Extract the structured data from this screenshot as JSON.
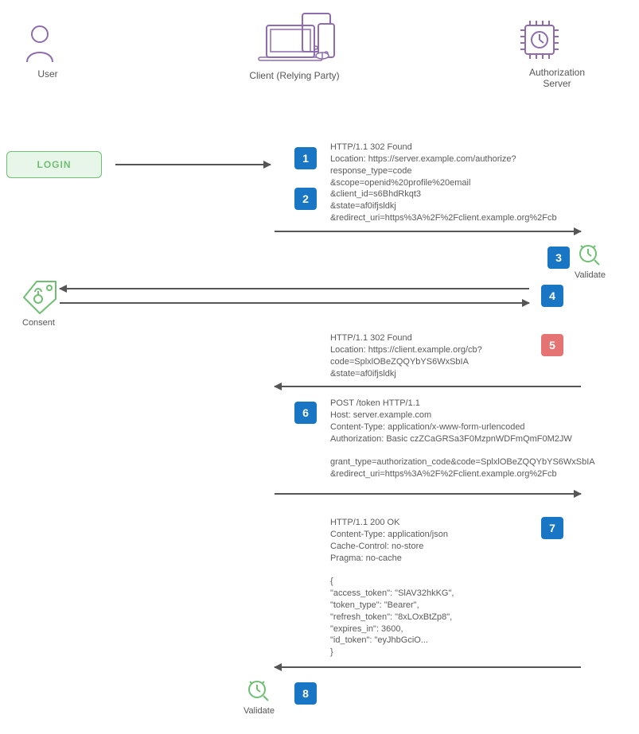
{
  "actors": {
    "user": "User",
    "client": "Client (Relying Party)",
    "server": "Authorization Server"
  },
  "login_label": "LOGIN",
  "validate_label_1": "Validate",
  "validate_label_2": "Validate",
  "consent_label": "Consent",
  "steps": {
    "s1": "1",
    "s2": "2",
    "s3": "3",
    "s4": "4",
    "s5": "5",
    "s6": "6",
    "s7": "7",
    "s8": "8"
  },
  "msg1": "HTTP/1.1 302 Found\nLocation: https://server.example.com/authorize?\nresponse_type=code\n&scope=openid%20profile%20email\n&client_id=s6BhdRkqt3\n&state=af0ifjsldkj\n&redirect_uri=https%3A%2F%2Fclient.example.org%2Fcb",
  "msg5": "HTTP/1.1 302 Found\nLocation: https://client.example.org/cb?\ncode=SplxlOBeZQQYbYS6WxSbIA\n&state=af0ifjsldkj",
  "msg6": "POST /token HTTP/1.1\nHost: server.example.com\nContent-Type: application/x-www-form-urlencoded\nAuthorization: Basic czZCaGRSa3F0MzpnWDFmQmF0M2JW\n\ngrant_type=authorization_code&code=SplxlOBeZQQYbYS6WxSbIA\n&redirect_uri=https%3A%2F%2Fclient.example.org%2Fcb",
  "msg7": "HTTP/1.1 200 OK\nContent-Type: application/json\nCache-Control: no-store\nPragma: no-cache\n\n{\n\"access_token\": \"SlAV32hkKG\",\n\"token_type\": \"Bearer\",\n\"refresh_token\": \"8xLOxBtZp8\",\n\"expires_in\": 3600,\n\"id_token\": \"eyJhbGciO...\n}",
  "colors": {
    "step_blue": "#1976c4",
    "step_red": "#e57373",
    "green": "#6fbf73",
    "purple": "#8e6caf"
  }
}
